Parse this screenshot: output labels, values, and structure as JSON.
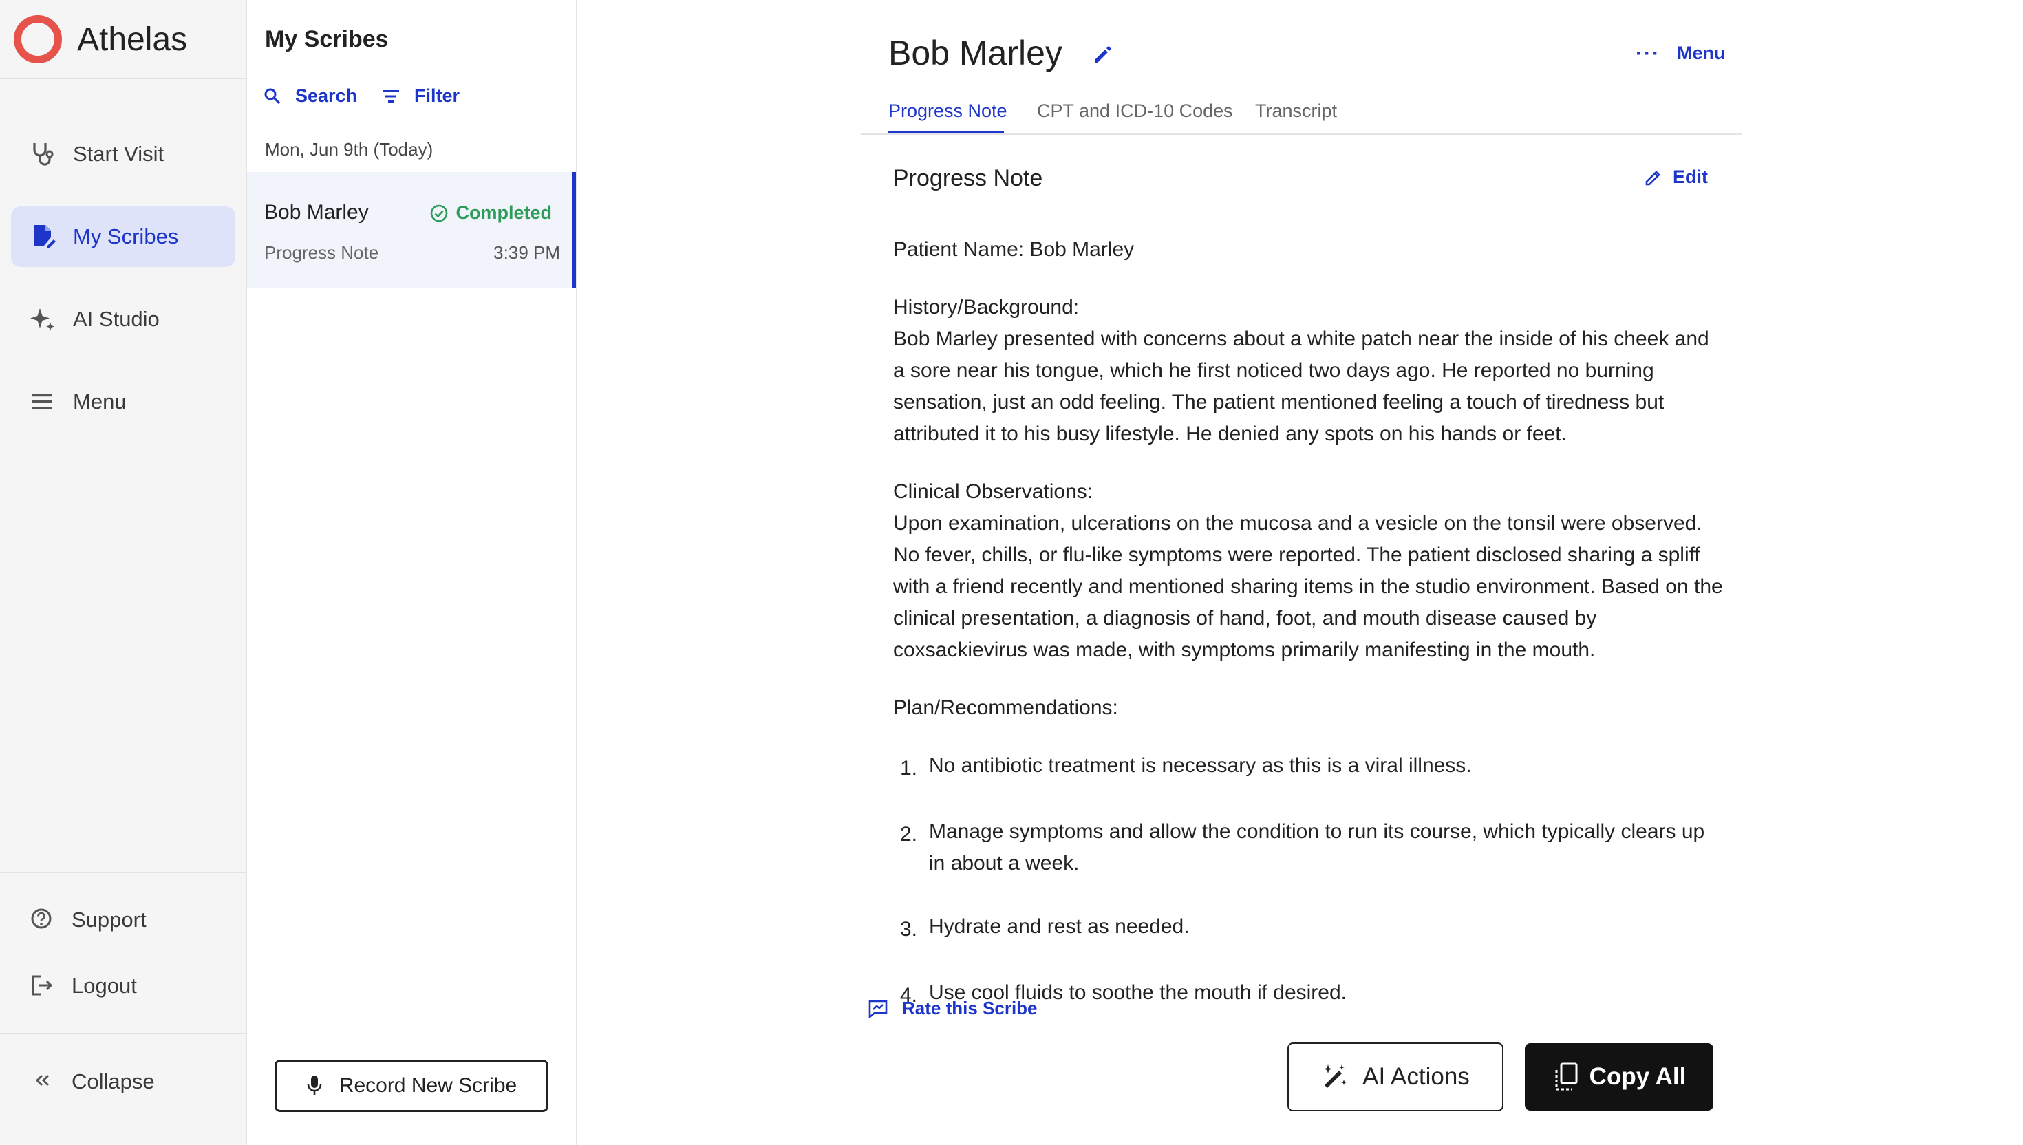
{
  "app": {
    "name": "Athelas"
  },
  "nav": {
    "items": [
      {
        "label": "Start Visit",
        "icon": "stethoscope-icon"
      },
      {
        "label": "My Scribes",
        "icon": "document-edit-icon",
        "active": true
      },
      {
        "label": "AI Studio",
        "icon": "sparkle-icon"
      },
      {
        "label": "Menu",
        "icon": "hamburger-menu-icon"
      }
    ],
    "bottom": [
      {
        "label": "Support",
        "icon": "help-circle-icon"
      },
      {
        "label": "Logout",
        "icon": "logout-icon"
      }
    ],
    "collapse_label": "Collapse"
  },
  "scribes": {
    "title": "My Scribes",
    "search_label": "Search",
    "filter_label": "Filter",
    "date_group": "Mon, Jun 9th (Today)",
    "items": [
      {
        "name": "Bob Marley",
        "status": "Completed",
        "type": "Progress Note",
        "time": "3:39 PM"
      }
    ],
    "record_label": "Record New Scribe"
  },
  "main": {
    "patient_name": "Bob Marley",
    "menu_label": "Menu",
    "tabs": [
      "Progress Note",
      "CPT and ICD-10 Codes",
      "Transcript"
    ],
    "active_tab": "Progress Note",
    "note": {
      "title": "Progress Note",
      "edit_label": "Edit",
      "patient_line": "Patient Name: Bob Marley",
      "history_heading": "History/Background:",
      "history_text": "Bob Marley presented with concerns about a white patch near the inside of his cheek and a sore near his tongue, which he first noticed two days ago. He reported no burning sensation, just an odd feeling. The patient mentioned feeling a touch of tiredness but attributed it to his busy lifestyle. He denied any spots on his hands or feet.",
      "clinical_heading": "Clinical Observations:",
      "clinical_text": "Upon examination, ulcerations on the mucosa and a vesicle on the tonsil were observed. No fever, chills, or flu-like symptoms were reported. The patient disclosed sharing a spliff with a friend recently and mentioned sharing items in the studio environment. Based on the clinical presentation, a diagnosis of hand, foot, and mouth disease caused by coxsackievirus was made, with symptoms primarily manifesting in the mouth.",
      "plan_heading": "Plan/Recommendations:",
      "plan_items": [
        "No antibiotic treatment is necessary as this is a viral illness.",
        "Manage symptoms and allow the condition to run its course, which typically clears up in about a week.",
        "Hydrate and rest as needed.",
        "Use cool fluids to soothe the mouth if desired."
      ]
    },
    "rate_label": "Rate this Scribe",
    "ai_actions_label": "AI Actions",
    "copy_all_label": "Copy All"
  },
  "colors": {
    "accent": "#1d36c9",
    "success": "#2e9c59",
    "brand": "#e5534b",
    "active_bg": "#dfe3fa"
  }
}
